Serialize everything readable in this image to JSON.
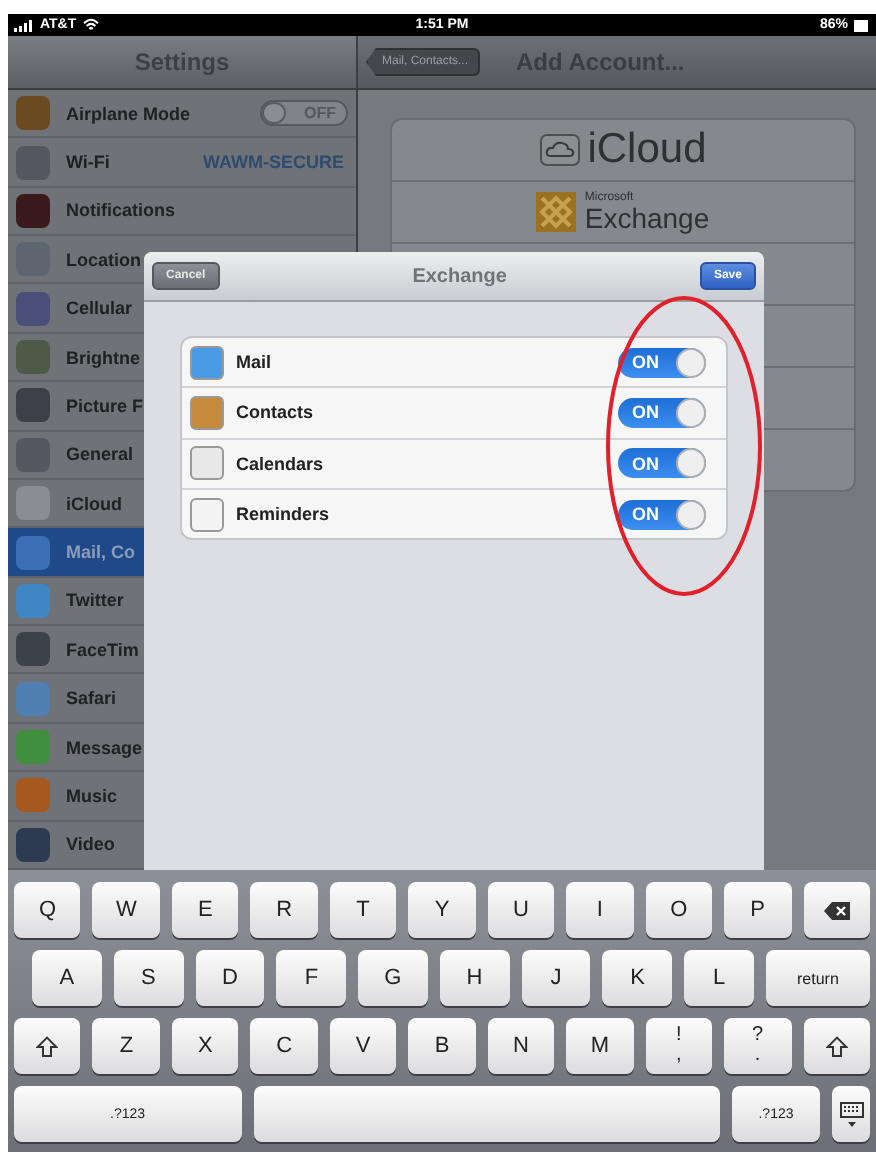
{
  "status_bar": {
    "carrier": "AT&T",
    "time": "1:51 PM",
    "battery": "86%"
  },
  "sidebar": {
    "title": "Settings",
    "items": [
      {
        "label": "Airplane Mode",
        "kind": "toggle",
        "on": false,
        "toggle_label": "OFF",
        "selected": false
      },
      {
        "label": "Wi-Fi",
        "kind": "value",
        "value": "WAWM-SECURE",
        "selected": false
      },
      {
        "label": "Notifications",
        "kind": "plain",
        "selected": false
      },
      {
        "label": "Location",
        "kind": "plain",
        "selected": false
      },
      {
        "label": "Cellular",
        "kind": "plain",
        "selected": false
      },
      {
        "label": "Brightne",
        "kind": "plain",
        "selected": false
      },
      {
        "label": "Picture F",
        "kind": "plain",
        "selected": false
      },
      {
        "label": "General",
        "kind": "plain",
        "selected": false
      },
      {
        "label": "iCloud",
        "kind": "plain",
        "selected": false
      },
      {
        "label": "Mail, Co",
        "kind": "plain",
        "selected": true
      },
      {
        "label": "Twitter",
        "kind": "plain",
        "selected": false
      },
      {
        "label": "FaceTim",
        "kind": "plain",
        "selected": false
      },
      {
        "label": "Safari",
        "kind": "plain",
        "selected": false
      },
      {
        "label": "Message",
        "kind": "plain",
        "selected": false
      },
      {
        "label": "Music",
        "kind": "plain",
        "selected": false
      },
      {
        "label": "Video",
        "kind": "plain",
        "selected": false
      }
    ]
  },
  "detail": {
    "back_button": "Mail, Contacts...",
    "title": "Add Account...",
    "accounts": [
      {
        "kind": "icloud",
        "name": "iCloud"
      },
      {
        "kind": "exchange",
        "brand": "Microsoft",
        "name": "Exchange"
      }
    ]
  },
  "modal": {
    "title": "Exchange",
    "cancel_button": "Cancel",
    "save_button": "Save",
    "services": [
      {
        "name": "Mail",
        "on": true,
        "toggle_label": "ON"
      },
      {
        "name": "Contacts",
        "on": true,
        "toggle_label": "ON"
      },
      {
        "name": "Calendars",
        "on": true,
        "toggle_label": "ON"
      },
      {
        "name": "Reminders",
        "on": true,
        "toggle_label": "ON"
      }
    ]
  },
  "annotation": {
    "kind": "ellipse"
  },
  "keyboard": {
    "rows": [
      {
        "keys": [
          {
            "kind": "char",
            "label": "Q"
          },
          {
            "kind": "char",
            "label": "W"
          },
          {
            "kind": "char",
            "label": "E"
          },
          {
            "kind": "char",
            "label": "R"
          },
          {
            "kind": "char",
            "label": "T"
          },
          {
            "kind": "char",
            "label": "Y"
          },
          {
            "kind": "char",
            "label": "U"
          },
          {
            "kind": "char",
            "label": "I"
          },
          {
            "kind": "char",
            "label": "O"
          },
          {
            "kind": "char",
            "label": "P"
          },
          {
            "kind": "backspace"
          }
        ]
      },
      {
        "keys": [
          {
            "kind": "char",
            "label": "A"
          },
          {
            "kind": "char",
            "label": "S"
          },
          {
            "kind": "char",
            "label": "D"
          },
          {
            "kind": "char",
            "label": "F"
          },
          {
            "kind": "char",
            "label": "G"
          },
          {
            "kind": "char",
            "label": "H"
          },
          {
            "kind": "char",
            "label": "J"
          },
          {
            "kind": "char",
            "label": "K"
          },
          {
            "kind": "char",
            "label": "L"
          },
          {
            "kind": "wide",
            "label": "return"
          }
        ]
      },
      {
        "keys": [
          {
            "kind": "shift"
          },
          {
            "kind": "char",
            "label": "Z"
          },
          {
            "kind": "char",
            "label": "X"
          },
          {
            "kind": "char",
            "label": "C"
          },
          {
            "kind": "char",
            "label": "V"
          },
          {
            "kind": "char",
            "label": "B"
          },
          {
            "kind": "char",
            "label": "N"
          },
          {
            "kind": "char",
            "label": "M"
          },
          {
            "kind": "dual",
            "label": "!",
            "sub": ","
          },
          {
            "kind": "dual",
            "label": "?",
            "sub": "."
          },
          {
            "kind": "shift"
          }
        ]
      },
      {
        "keys": [
          {
            "kind": "mode",
            "label": ".?123"
          },
          {
            "kind": "space"
          },
          {
            "kind": "small",
            "label": ".?123"
          },
          {
            "kind": "hide"
          }
        ]
      }
    ]
  }
}
